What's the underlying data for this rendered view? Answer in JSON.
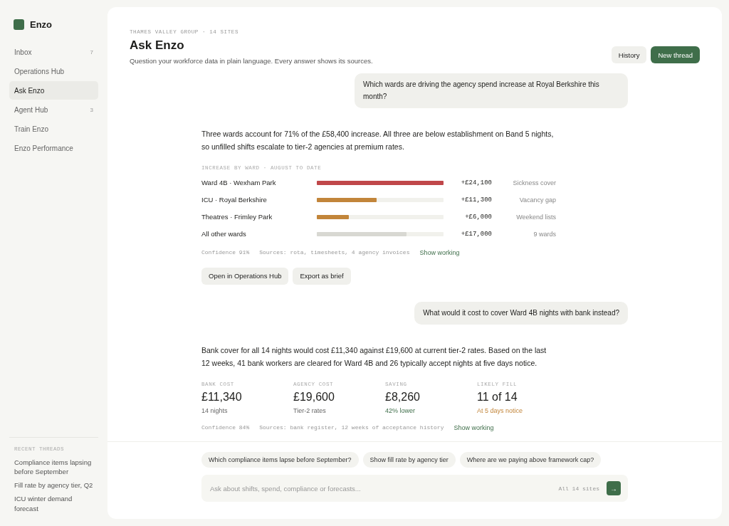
{
  "app": {
    "name": "Enzo"
  },
  "sidebar": {
    "items": [
      {
        "label": "Inbox",
        "count": "7",
        "selected": false
      },
      {
        "label": "Operations Hub",
        "selected": false
      },
      {
        "label": "Ask Enzo",
        "selected": true
      },
      {
        "label": "Agent Hub",
        "count": "3",
        "selected": false
      },
      {
        "label": "Train Enzo",
        "selected": false
      },
      {
        "label": "Enzo Performance",
        "selected": false
      }
    ],
    "recent_heading": "RECENT THREADS",
    "recent_threads": [
      "Compliance items lapsing before September",
      "Fill rate by agency tier, Q2",
      "ICU winter demand forecast"
    ]
  },
  "header": {
    "eyebrow": "THAMES VALLEY GROUP · 14 SITES",
    "title": "Ask Enzo",
    "subtitle": "Question your workforce data in plain language. Every answer shows its sources.",
    "buttons": [
      {
        "label": "History",
        "kind": "secondary"
      },
      {
        "label": "New thread",
        "kind": "primary"
      }
    ]
  },
  "thread": [
    {
      "kind": "question",
      "text": "Which wards are driving the agency spend increase at Royal Berkshire this month?"
    },
    {
      "kind": "breakdown",
      "text": "Three wards account for 71% of the £58,400 increase. All three are below establishment on Band 5 nights, so unfilled shifts escalate to tier-2 agencies at premium rates.",
      "heading": "INCREASE BY WARD · AUGUST TO DATE",
      "rows": [
        {
          "label": "Ward 4B · Wexham Park",
          "level": 1.0,
          "color": "#c0474a",
          "amount": "+£24,100",
          "note": "Sickness cover"
        },
        {
          "label": "ICU · Royal Berkshire",
          "level": 0.47,
          "color": "#c2853a",
          "amount": "+£11,300",
          "note": "Vacancy gap"
        },
        {
          "label": "Theatres · Frimley Park",
          "level": 0.25,
          "color": "#c2853a",
          "amount": "+£6,000",
          "note": "Weekend lists"
        },
        {
          "label": "All other wards",
          "level": 0.71,
          "color": "#d8d8d2",
          "amount": "+£17,000",
          "note": "9 wards"
        }
      ],
      "confidence": "Confidence 91%",
      "sources": "Sources: rota, timesheets, 4 agency invoices",
      "link": "Show working",
      "actions": [
        "Open in Operations Hub",
        "Export as brief"
      ]
    },
    {
      "kind": "question",
      "text": "What would it cost to cover Ward 4B nights with bank instead?"
    },
    {
      "kind": "stats",
      "text": "Bank cover for all 14 nights would cost £11,340 against £19,600 at current tier-2 rates. Based on the last 12 weeks, 41 bank workers are cleared for Ward 4B and 26 typically accept nights at five days notice.",
      "stats": [
        {
          "label": "BANK COST",
          "value": "£11,340",
          "note": "14 nights",
          "kind": "neutral"
        },
        {
          "label": "AGENCY COST",
          "value": "£19,600",
          "note": "Tier-2 rates",
          "kind": "neutral"
        },
        {
          "label": "SAVING",
          "value": "£8,260",
          "note": "42% lower",
          "kind": "positive"
        },
        {
          "label": "LIKELY FILL",
          "value": "11 of 14",
          "note": "At 5 days notice",
          "kind": "warning"
        }
      ],
      "confidence": "Confidence 84%",
      "sources": "Sources: bank register, 12 weeks of acceptance history",
      "link": "Show working"
    }
  ],
  "suggestions": [
    "Which compliance items lapse before September?",
    "Show fill rate by agency tier",
    "Where are we paying above framework cap?"
  ],
  "composer": {
    "placeholder": "Ask about shifts, spend, compliance or forecasts...",
    "scope": "All 14 sites",
    "send": "→"
  }
}
